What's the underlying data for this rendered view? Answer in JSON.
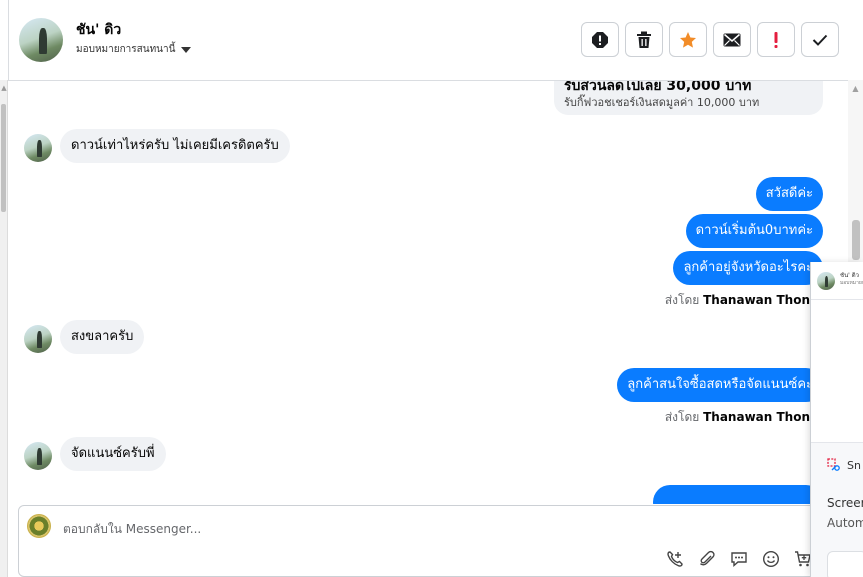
{
  "header": {
    "contact_name": "ชัน' ดิว",
    "assign_label": "มอบหมายการสนทนานี้",
    "tools": [
      {
        "name": "mark-spam-icon"
      },
      {
        "name": "trash-icon"
      },
      {
        "name": "star-icon",
        "color": "#f28c28"
      },
      {
        "name": "mail-icon"
      },
      {
        "name": "follow-up-icon",
        "color": "#e41e3f"
      },
      {
        "name": "check-icon"
      }
    ]
  },
  "promo": {
    "line1": "รับส่วนลดไปเลย 30,000 บาท",
    "line2": "รับกิ๊ฟวอชเชอร์เงินสดมูลค่า 10,000 บาท"
  },
  "messages": [
    {
      "dir": "in",
      "text": "ดาวน์เท่าไหร่ครับ ไม่เคยมีเครดิตครับ"
    },
    {
      "dir": "out",
      "text": "สวัสดีค่ะ"
    },
    {
      "dir": "out",
      "text": "ดาวน์เริ่มต้น0บาทค่ะ"
    },
    {
      "dir": "out",
      "text": "ลูกค้าอยู่จังหวัดอะไรคะ"
    },
    {
      "dir": "in",
      "text": "สงขลาครับ"
    },
    {
      "dir": "out",
      "text": "ลูกค้าสนใจซื้อสดหรือจัดแนนซ์คะ"
    },
    {
      "dir": "in",
      "text": "จัดแนนซ์ครับพี่"
    }
  ],
  "sent_by": {
    "prefix": "ส่งโดย",
    "agent": "Thanawan Thon"
  },
  "composer": {
    "placeholder": "ตอบกลับใน Messenger...",
    "icons": [
      "add-contact-icon",
      "attach-icon",
      "saved-reply-icon",
      "emoji-icon",
      "cart-icon"
    ]
  },
  "overlay": {
    "name": "ชัน' ดิว",
    "sub": "มอบหมายการ",
    "app": "Sn",
    "line1": "Screer",
    "line2": "Autom"
  },
  "colors": {
    "accent": "#0a7cff",
    "incoming_bg": "#f0f2f5"
  }
}
